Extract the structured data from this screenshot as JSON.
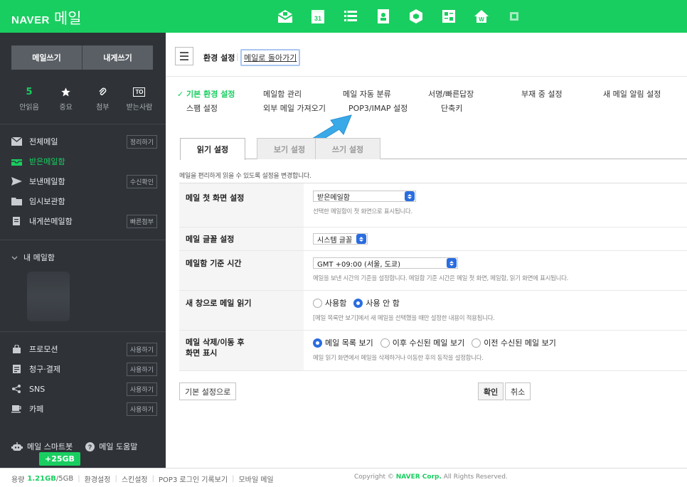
{
  "topbar": {
    "brand": "NAVER",
    "app_name": "메일",
    "apps": [
      {
        "name": "mail-app-icon",
        "color": "#ffffff"
      },
      {
        "name": "calendar-app-icon",
        "label": "31"
      },
      {
        "name": "memo-app-icon"
      },
      {
        "name": "contacts-app-icon"
      },
      {
        "name": "cube-app-icon"
      },
      {
        "name": "office-app-icon"
      },
      {
        "name": "pay-app-icon",
        "label": "W"
      },
      {
        "name": "more-app-icon"
      }
    ],
    "bg_color": "#19ce60"
  },
  "sidebar": {
    "compose_label": "메일쓰기",
    "self_compose_label": "내게쓰기",
    "quick": [
      {
        "value": "5",
        "label": "안읽음"
      },
      {
        "value": "★",
        "label": "중요"
      },
      {
        "value": "📎",
        "label": "첨부"
      },
      {
        "value": "TO",
        "label": "받는사람"
      }
    ],
    "folders": [
      {
        "label": "전체메일",
        "action": "정리하기"
      },
      {
        "label": "받은메일함",
        "action": "",
        "active": true
      },
      {
        "label": "보낸메일함",
        "action": "수신확인"
      },
      {
        "label": "임시보관함",
        "action": ""
      },
      {
        "label": "내게쓴메일함",
        "action": "빠른첨부"
      }
    ],
    "my_mailbox": "내 메일함",
    "services": [
      {
        "label": "프로모션",
        "action": "사용하기"
      },
      {
        "label": "청구·결제",
        "action": "사용하기"
      },
      {
        "label": "SNS",
        "action": "사용하기"
      },
      {
        "label": "카페",
        "action": "사용하기"
      }
    ],
    "smartbot": "메일 스마트봇",
    "help": "메일 도움말",
    "storage_badge": "+25GB"
  },
  "footer": {
    "storage_prefix": "용량",
    "storage_used": "1.21GB",
    "storage_total": "/5GB",
    "links": [
      "환경설정",
      "스킨설정",
      "POP3 로그인 기록보기",
      "모바일 메일"
    ],
    "copyright_prefix": "Copyright ©",
    "copyright_brand": "NAVER Corp.",
    "copyright_suffix": "All Rights Reserved."
  },
  "header": {
    "title": "환경 설정",
    "back_link": "메일로 돌아가기"
  },
  "settings_nav": [
    {
      "label": "✓ 기본 환경 설정",
      "active": true
    },
    {
      "label": "메일함 관리"
    },
    {
      "label": "메일 자동 분류"
    },
    {
      "label": "서명/빠른답장"
    },
    {
      "label": "부재 중 설정"
    },
    {
      "label": "새 메일 알림 설정"
    },
    {
      "label": "스팸 설정"
    },
    {
      "label": "외부 메일 가져오기"
    },
    {
      "label": "POP3/IMAP 설정"
    },
    {
      "label": "단축키"
    }
  ],
  "tabs": [
    {
      "label": "읽기 설정",
      "active": true
    },
    {
      "label": "보기 설정"
    },
    {
      "label": "쓰기 설정"
    }
  ],
  "description": "메일을 편리하게 읽을 수 있도록 설정을 변경합니다.",
  "settings": {
    "first_screen": {
      "label": "메일 첫 화면 설정",
      "value": "받은메일함",
      "hint": "선택한 메일함이 첫 화면으로 표시됩니다."
    },
    "font": {
      "label": "메일 글꼴 설정",
      "value": "시스템 글꼴"
    },
    "timezone": {
      "label": "메일함 기준 시간",
      "value": "GMT +09:00 (서울, 도쿄)",
      "hint": "메일을 보낸 시간의 기준을 설정합니다. 메일함 기준 시간은 메일 첫 화면, 메일함, 읽기 화면에 표시됩니다."
    },
    "new_window": {
      "label": "새 창으로 메일 읽기",
      "options": [
        "사용함",
        "사용 안 함"
      ],
      "selected": 1,
      "hint": "[메일 목록만 보기]에서 새 메일을 선택했을 때만 설정한 내용이 적용됩니다."
    },
    "after_delete": {
      "label_line1": "메일 삭제/이동 후",
      "label_line2": "화면 표시",
      "options": [
        "메일 목록 보기",
        "이후 수신된 메일 보기",
        "이전 수신된 메일 보기"
      ],
      "selected": 0,
      "hint": "메일 읽기 화면에서 메일을 삭제하거나 이동한 후의 동작을 설정합니다."
    }
  },
  "buttons": {
    "reset": "기본 설정으로",
    "confirm": "확인",
    "cancel": "취소"
  }
}
